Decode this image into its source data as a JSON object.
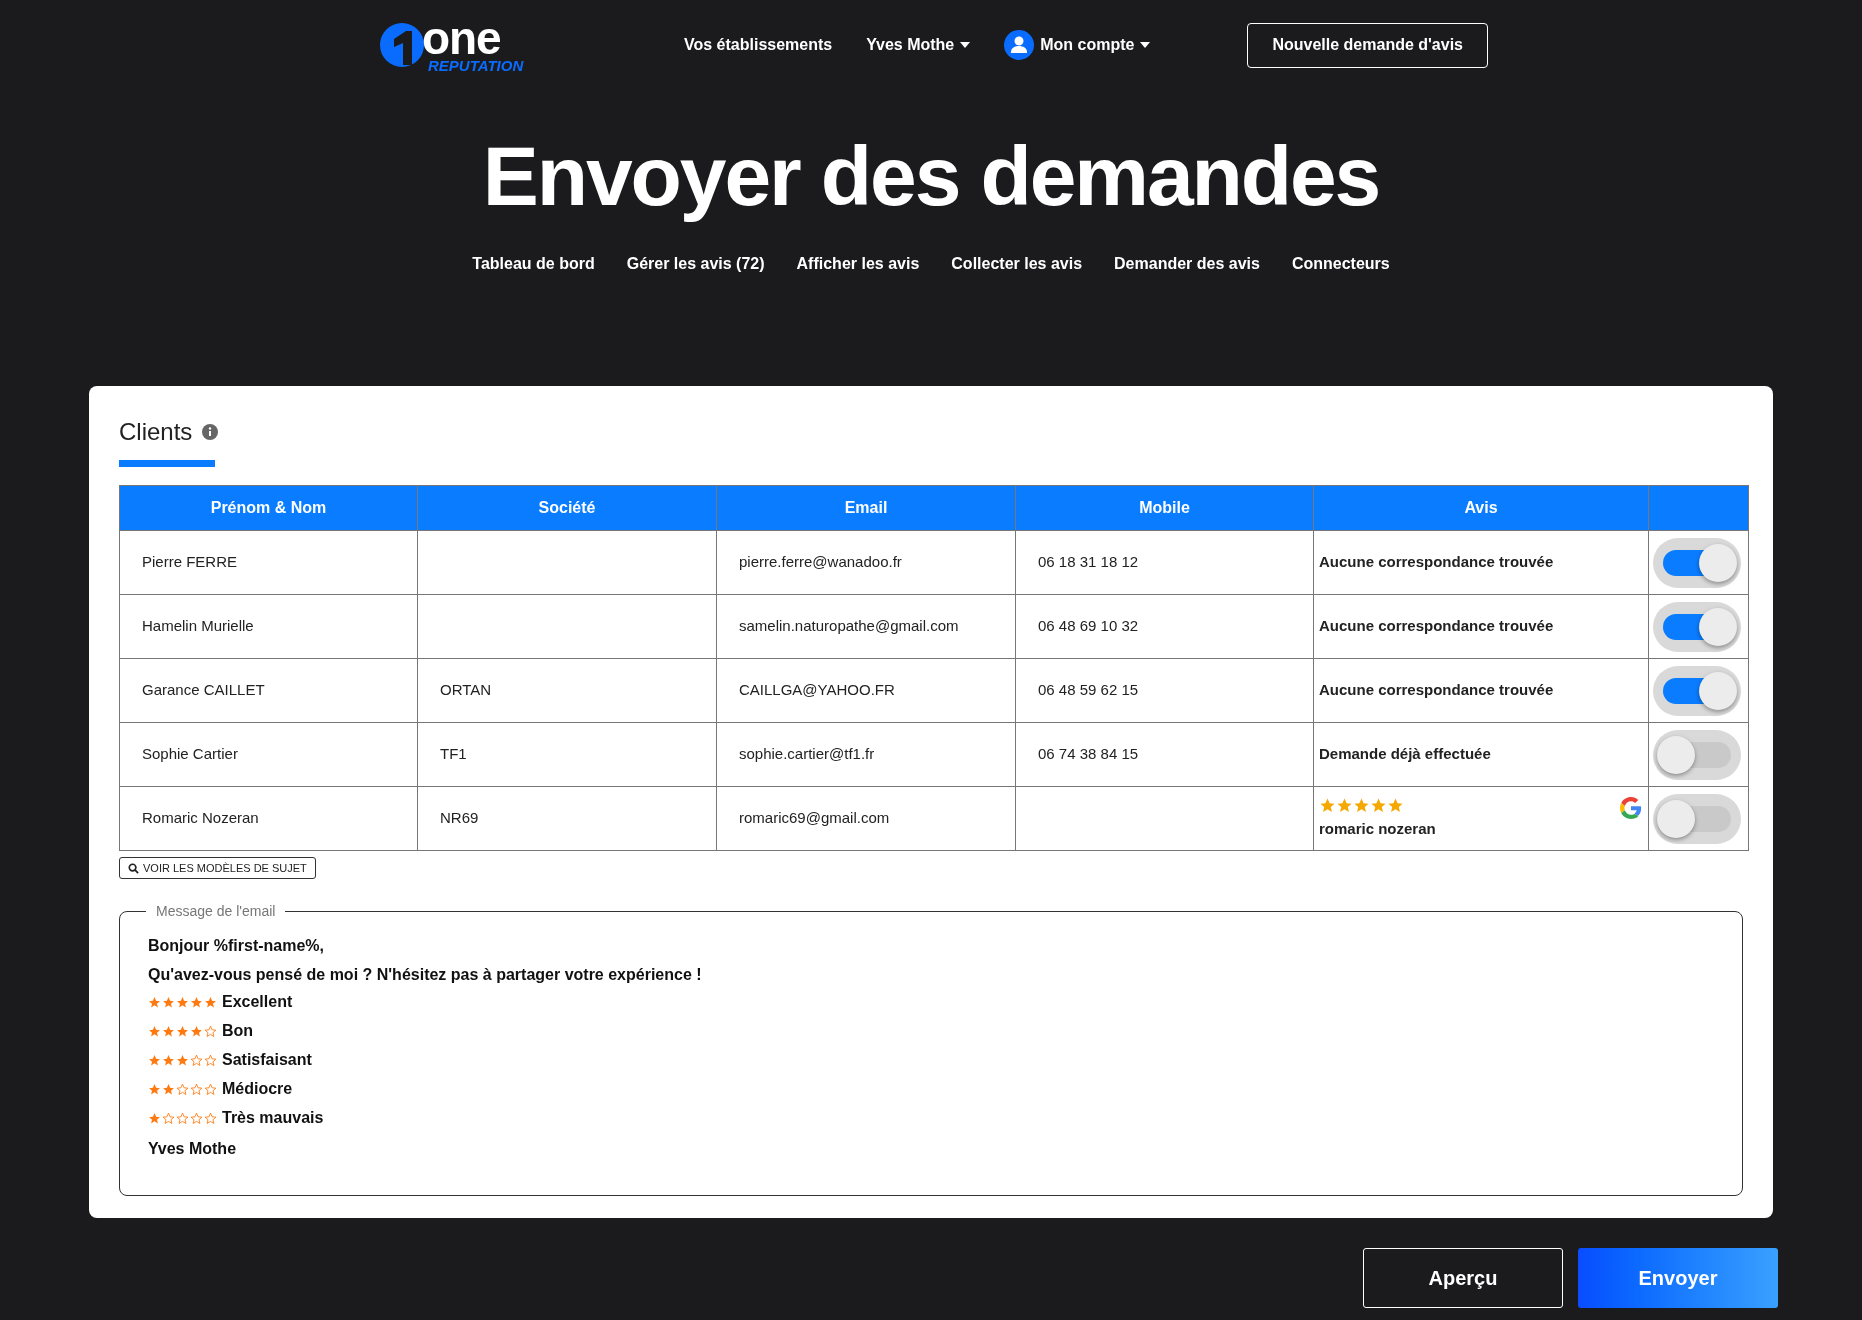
{
  "header": {
    "logo": {
      "word": "one",
      "tagline": "REPUTATION"
    },
    "nav": [
      {
        "label": "Vos établissements",
        "dropdown": false,
        "avatar": false
      },
      {
        "label": "Yves Mothe",
        "dropdown": true,
        "avatar": false
      },
      {
        "label": "Mon compte",
        "dropdown": true,
        "avatar": true
      }
    ],
    "cta": "Nouvelle demande d'avis"
  },
  "title": "Envoyer des demandes",
  "tabs": [
    {
      "label": "Tableau de bord"
    },
    {
      "label": "Gérer les avis (72)"
    },
    {
      "label": "Afficher les avis"
    },
    {
      "label": "Collecter les avis"
    },
    {
      "label": "Demander des avis"
    },
    {
      "label": "Connecteurs"
    }
  ],
  "clients": {
    "title": "Clients",
    "columns": [
      "Prénom & Nom",
      "Société",
      "Email",
      "Mobile",
      "Avis"
    ],
    "rows": [
      {
        "name": "Pierre FERRE",
        "company": "",
        "email": "pierre.ferre@wanadoo.fr",
        "mobile": "06 18 31 18 12",
        "review": {
          "kind": "text",
          "text": "Aucune correspondance trouvée"
        },
        "on": true
      },
      {
        "name": "Hamelin Murielle",
        "company": "",
        "email": "samelin.naturopathe@gmail.com",
        "mobile": "06 48 69 10 32",
        "review": {
          "kind": "text",
          "text": "Aucune correspondance trouvée"
        },
        "on": true
      },
      {
        "name": "Garance CAILLET",
        "company": "ORTAN",
        "email": "CAILLGA@YAHOO.FR",
        "mobile": "06 48 59 62 15",
        "review": {
          "kind": "text",
          "text": "Aucune correspondance trouvée"
        },
        "on": true
      },
      {
        "name": "Sophie Cartier",
        "company": "TF1",
        "email": "sophie.cartier@tf1.fr",
        "mobile": "06 74 38 84 15",
        "review": {
          "kind": "text",
          "text": "Demande déjà effectuée"
        },
        "on": false
      },
      {
        "name": "Romaric Nozeran",
        "company": "NR69",
        "email": "romaric69@gmail.com",
        "mobile": "",
        "review": {
          "kind": "google",
          "stars": 5,
          "text": "romaric nozeran"
        },
        "on": false
      }
    ],
    "templates_button": "VOIR LES MODÈLES DE SUJET"
  },
  "message": {
    "legend": "Message de l'email",
    "lines": [
      {
        "kind": "text",
        "text": "Bonjour %first-name%,"
      },
      {
        "kind": "text",
        "text": "Qu'avez-vous pensé de moi ? N'hésitez pas à partager votre expérience !"
      },
      {
        "kind": "rating",
        "stars": 5,
        "text": "Excellent"
      },
      {
        "kind": "rating",
        "stars": 4,
        "text": "Bon"
      },
      {
        "kind": "rating",
        "stars": 3,
        "text": "Satisfaisant"
      },
      {
        "kind": "rating",
        "stars": 2,
        "text": "Médiocre"
      },
      {
        "kind": "rating",
        "stars": 1,
        "text": "Très mauvais"
      },
      {
        "kind": "text",
        "text": "Yves Mothe"
      }
    ]
  },
  "actions": [
    {
      "label": "Aperçu",
      "kind": "outline"
    },
    {
      "label": "Envoyer",
      "kind": "primary"
    }
  ]
}
